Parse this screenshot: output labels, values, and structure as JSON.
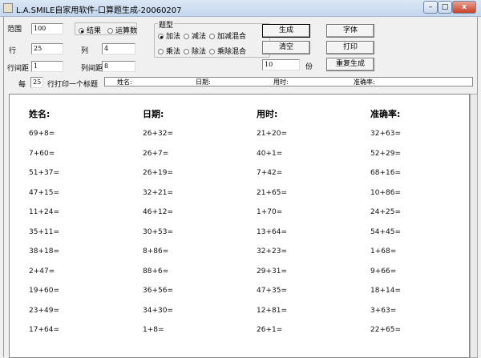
{
  "window": {
    "title": "L.A.SMILE自家用软件-口算题生成-20060207",
    "min": "–",
    "max": "□",
    "close": "x"
  },
  "form": {
    "range_label": "范围",
    "range_value": "100",
    "rows_label": "行",
    "rows_value": "25",
    "cols_label": "列",
    "cols_value": "4",
    "row_gap_label": "行间距",
    "row_gap_value": "1",
    "col_gap_label": "列间距",
    "col_gap_value": "8",
    "result_label": "结果",
    "operand_label": "运算数",
    "type_group": "题型",
    "types": [
      "加法",
      "减法",
      "加减混合",
      "乘法",
      "除法",
      "乘除混合"
    ],
    "every_label": "每",
    "every_value": "25",
    "every_suffix": "行打印一个标题",
    "copies_value": "10",
    "copies_label": "份"
  },
  "buttons": {
    "generate": "生成",
    "clear": "清空",
    "font": "字体",
    "print": "打印",
    "regenerate": "重复生成"
  },
  "header_bar": {
    "name": "姓名:",
    "date": "日期:",
    "time": "用时:",
    "accuracy": "准确率:"
  },
  "sheet": {
    "headers": [
      "姓名:",
      "日期:",
      "用时:",
      "准确率:"
    ],
    "rows": [
      [
        "69+8=",
        "26+32=",
        "21+20=",
        "32+63="
      ],
      [
        "7+60=",
        "26+7=",
        "40+1=",
        "52+29="
      ],
      [
        "51+37=",
        "26+19=",
        "7+42=",
        "68+16="
      ],
      [
        "47+15=",
        "32+21=",
        "21+65=",
        "10+86="
      ],
      [
        "11+24=",
        "46+12=",
        "1+70=",
        "24+25="
      ],
      [
        "35+11=",
        "30+53=",
        "13+64=",
        "54+45="
      ],
      [
        "38+18=",
        "8+86=",
        "32+23=",
        "1+68="
      ],
      [
        "2+47=",
        "88+6=",
        "29+31=",
        "9+66="
      ],
      [
        "19+60=",
        "36+56=",
        "47+35=",
        "18+14="
      ],
      [
        "23+49=",
        "34+30=",
        "12+81=",
        "3+63="
      ],
      [
        "17+64=",
        "1+8=",
        "26+1=",
        "22+65="
      ]
    ]
  }
}
